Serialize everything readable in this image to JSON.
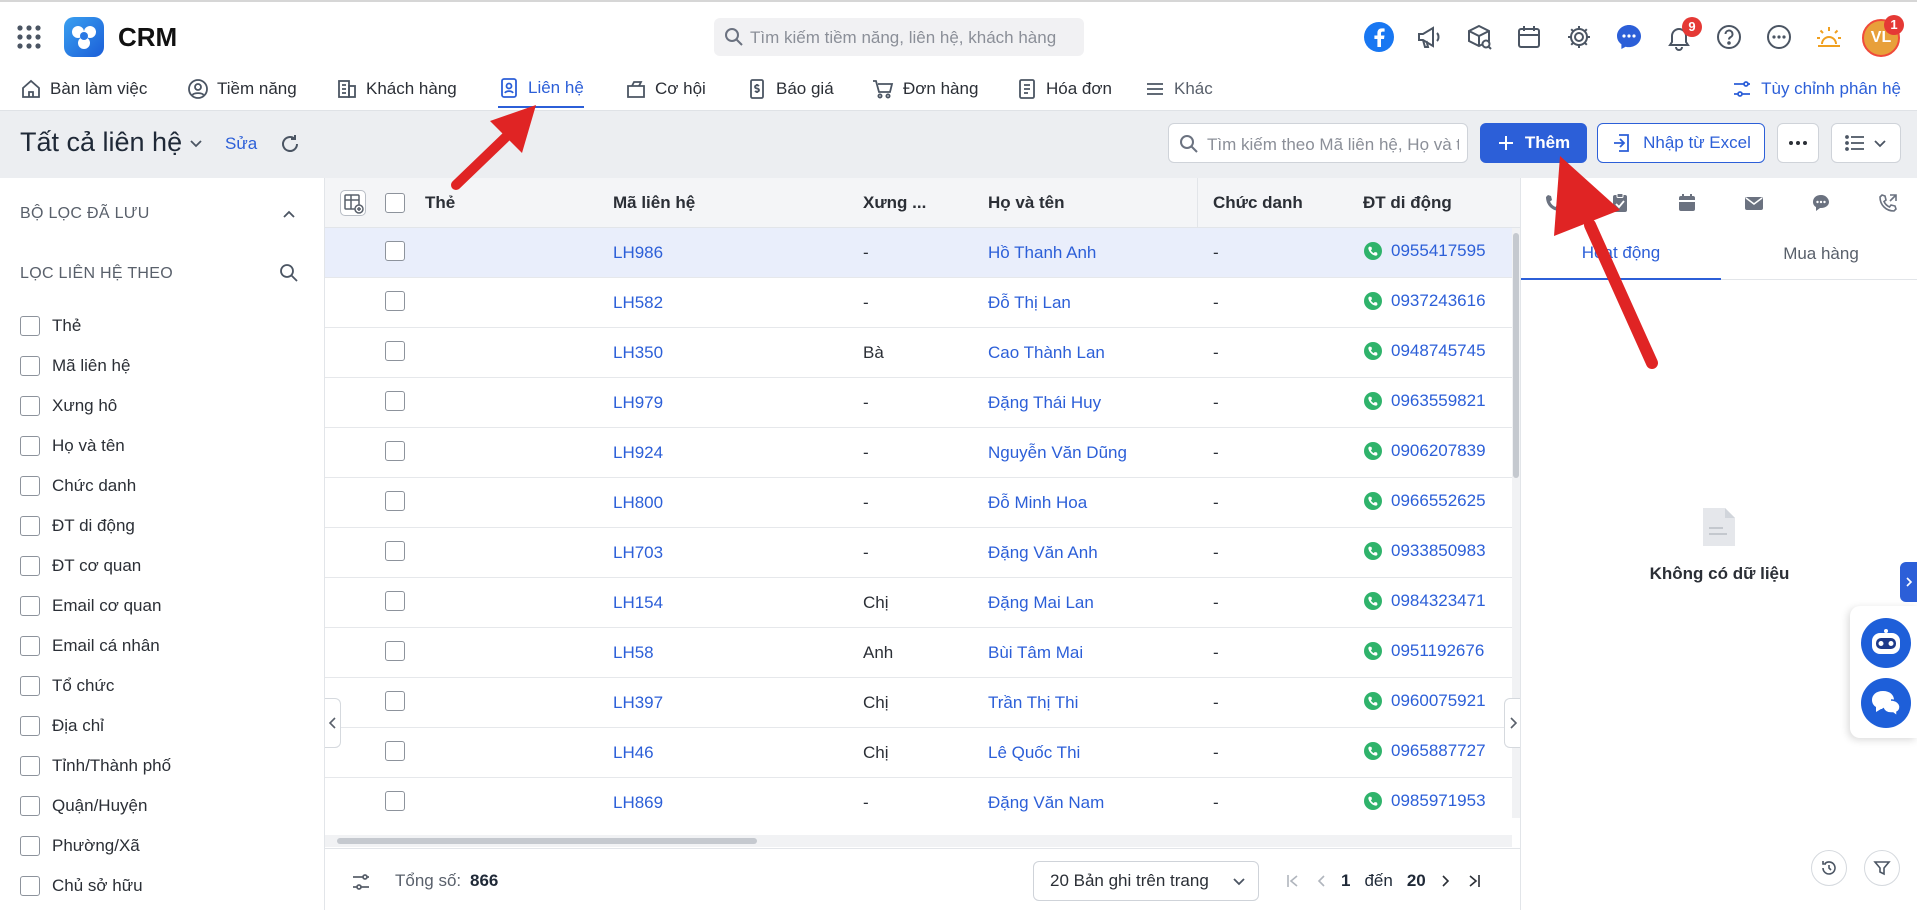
{
  "app": {
    "brand": "CRM",
    "global_search_placeholder": "Tìm kiếm tiềm năng, liên hệ, khách hàng",
    "notification_count": "9",
    "avatar_initials": "VL",
    "avatar_badge": "1"
  },
  "nav": {
    "items": [
      {
        "label": "Bàn làm việc",
        "icon": "home-icon"
      },
      {
        "label": "Tiềm năng",
        "icon": "user-circle-icon"
      },
      {
        "label": "Khách hàng",
        "icon": "building-icon"
      },
      {
        "label": "Liên hệ",
        "icon": "contact-card-icon",
        "active": true
      },
      {
        "label": "Cơ hội",
        "icon": "briefcase-icon"
      },
      {
        "label": "Báo giá",
        "icon": "dollar-doc-icon"
      },
      {
        "label": "Đơn hàng",
        "icon": "cart-icon"
      },
      {
        "label": "Hóa đơn",
        "icon": "invoice-icon"
      },
      {
        "label": "Khác",
        "icon": "menu-lines-icon"
      }
    ],
    "customize_label": "Tùy chỉnh phân hệ"
  },
  "header": {
    "view_title": "Tất cả liên hệ",
    "edit_label": "Sửa",
    "search_placeholder": "Tìm kiếm theo Mã liên hệ, Họ và tên, ĐT di động",
    "add_label": "Thêm",
    "import_label": "Nhập từ Excel"
  },
  "filters": {
    "saved_title": "BỘ LỌC ĐÃ LƯU",
    "filter_by_title": "LỌC LIÊN HỆ THEO",
    "items": [
      "Thẻ",
      "Mã liên hệ",
      "Xưng hô",
      "Họ và tên",
      "Chức danh",
      "ĐT di động",
      "ĐT cơ quan",
      "Email cơ quan",
      "Email cá nhân",
      "Tổ chức",
      "Địa chỉ",
      "Tỉnh/Thành phố",
      "Quận/Huyện",
      "Phường/Xã",
      "Chủ sở hữu"
    ]
  },
  "table": {
    "columns": [
      "Thẻ",
      "Mã liên hệ",
      "Xưng ...",
      "Họ và tên",
      "Chức danh",
      "ĐT di động"
    ],
    "rows": [
      {
        "tag": "",
        "code": "LH986",
        "salutation": "-",
        "name": "Hồ Thanh Anh",
        "title": "-",
        "mobile": "0955417595",
        "selected": true
      },
      {
        "tag": "",
        "code": "LH582",
        "salutation": "-",
        "name": "Đỗ Thị Lan",
        "title": "-",
        "mobile": "0937243616"
      },
      {
        "tag": "",
        "code": "LH350",
        "salutation": "Bà",
        "name": "Cao Thành Lan",
        "title": "-",
        "mobile": "0948745745"
      },
      {
        "tag": "",
        "code": "LH979",
        "salutation": "-",
        "name": "Đặng Thái Huy",
        "title": "-",
        "mobile": "0963559821"
      },
      {
        "tag": "",
        "code": "LH924",
        "salutation": "-",
        "name": "Nguyễn Văn Dũng",
        "title": "-",
        "mobile": "0906207839"
      },
      {
        "tag": "",
        "code": "LH800",
        "salutation": "-",
        "name": "Đỗ Minh Hoa",
        "title": "-",
        "mobile": "0966552625"
      },
      {
        "tag": "",
        "code": "LH703",
        "salutation": "-",
        "name": "Đặng Văn Anh",
        "title": "-",
        "mobile": "0933850983"
      },
      {
        "tag": "",
        "code": "LH154",
        "salutation": "Chị",
        "name": "Đặng Mai Lan",
        "title": "-",
        "mobile": "0984323471"
      },
      {
        "tag": "",
        "code": "LH58",
        "salutation": "Anh",
        "name": "Bùi Tâm Mai",
        "title": "-",
        "mobile": "0951192676"
      },
      {
        "tag": "",
        "code": "LH397",
        "salutation": "Chị",
        "name": "Trần Thị Thi",
        "title": "-",
        "mobile": "0960075921"
      },
      {
        "tag": "",
        "code": "LH46",
        "salutation": "Chị",
        "name": "Lê Quốc Thi",
        "title": "-",
        "mobile": "0965887727"
      },
      {
        "tag": "",
        "code": "LH869",
        "salutation": "-",
        "name": "Đặng Văn Nam",
        "title": "-",
        "mobile": "0985971953"
      }
    ],
    "footer": {
      "total_label": "Tổng số:",
      "total_value": "866",
      "page_size_label": "20 Bản ghi trên trang",
      "range_from": "1",
      "range_sep": "đến",
      "range_to": "20"
    }
  },
  "right_panel": {
    "tabs": [
      "Hoạt động",
      "Mua hàng"
    ],
    "empty_text": "Không có dữ liệu"
  },
  "colors": {
    "accent": "#2c5fd8",
    "phone_green": "#2fb36b",
    "annotation_red": "#e02424"
  }
}
